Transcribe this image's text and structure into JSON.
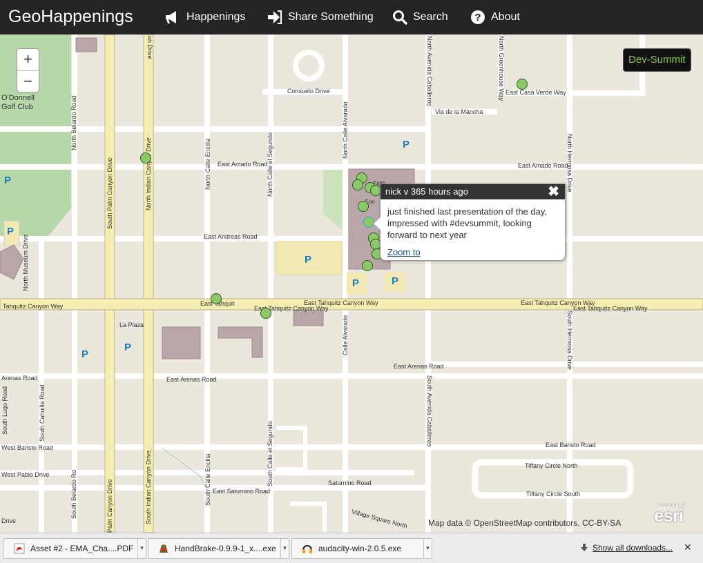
{
  "navbar": {
    "brand": "GeoHappenings",
    "items": [
      {
        "label": "Happenings",
        "icon": "megaphone-icon"
      },
      {
        "label": "Share Something",
        "icon": "sign-in-icon"
      },
      {
        "label": "Search",
        "icon": "search-icon"
      },
      {
        "label": "About",
        "icon": "question-circle-icon"
      }
    ]
  },
  "map": {
    "zoom_in": "+",
    "zoom_out": "−",
    "dev_summit": "Dev-Summit",
    "golf_club": "O'Donnell\nGolf Club",
    "streets": {
      "consuelo": "Consuelo Drive",
      "via_mancha": "Via de la Mancha",
      "casa_verde": "East Casa Verde Way",
      "amado_w": "East Amado Road",
      "amado_e": "East Amado Road",
      "andreas": "East Andreas Road",
      "tahquitz_w": "Tahquitz Canyon Way",
      "tahquitz_short": "East Tahquit",
      "tahquitz_1": "East Tahquitz Canyon Way",
      "tahquitz_2": "East Tahquitz Canyon Way",
      "tahquitz_3": "East Tahquitz Canyon Way",
      "tahquitz_4": "East Tahquitz Canyon Way",
      "la_plaza": "La Plaza",
      "arenas_w": "Arenas Road",
      "arenas_mid": "East Arenas Road",
      "arenas_e": "East Arenas Road",
      "baristo_w": "West Baristo Road",
      "baristo_e": "East Baristo Road",
      "pablo": "West Pablo Drive",
      "saturnino": "Saturnino Road",
      "sat_e": "East Saturnino Road",
      "tiffany_n": "Tiffany Circle North",
      "tiffany_s": "Tiffany Circle South",
      "village": "Village Square North",
      "drive": "Drive",
      "n_belardo": "North Belardo Road",
      "s_belardo": "South Belardo Ro",
      "s_palm": "South Palm Canyon Drive",
      "palm_canyon": "Palm Canyon Drive",
      "n_indian": "North Indian Canyon Drive",
      "on_drive": "on Drive",
      "s_indian": "South Indian Canyon Drive",
      "n_museum": "North Museum Drive",
      "s_cahuilla": "South Cahuilla Road",
      "s_lugo": "South Lugo Road",
      "n_enilia": "North Calle Encilia",
      "s_enilia": "South Calle Encilia",
      "n_segundo": "North Calle el Segundo",
      "s_segundo": "South Calle el Segundo",
      "n_alvarado": "North Calle Alvarado",
      "calle_alvarado": "Calle Alvarado",
      "n_caballeros": "North Avenida Caballeros",
      "s_caballeros": "South Avenida Caballeros",
      "greenhouse": "North Greenhouse Way",
      "n_hermosa": "North Hermosa Drive",
      "s_hermosa": "South Hermosa Drive",
      "convention": "Con",
      "palm_springs": "Palm"
    },
    "parking_label": "P",
    "attribution": "Map data © OpenStreetMap contributors, CC-BY-SA",
    "esri_powered": "POWERED BY",
    "esri": "esri"
  },
  "popup": {
    "title": "nick v 365 hours ago",
    "close": "✖",
    "body": "just finished last presentation of the day, impressed with #devsummit, looking forward to next year",
    "zoom_link": "Zoom to"
  },
  "downloads": {
    "items": [
      {
        "name": "Asset #2 - EMA_Cha....PDF",
        "icon": "pdf-icon"
      },
      {
        "name": "HandBrake-0.9.9-1_x....exe",
        "icon": "handbrake-icon"
      },
      {
        "name": "audacity-win-2.0.5.exe",
        "icon": "headphones-icon"
      }
    ],
    "show_all": "Show all downloads...",
    "close": "✕"
  },
  "colors": {
    "nav_bg": "#242424",
    "map_bg": "#ece7dd",
    "marker_fill": "#8cc86a",
    "dev_summit_text": "#8cc63f",
    "major_road": "#f5eeb0",
    "parking": "#1a7fc0"
  }
}
